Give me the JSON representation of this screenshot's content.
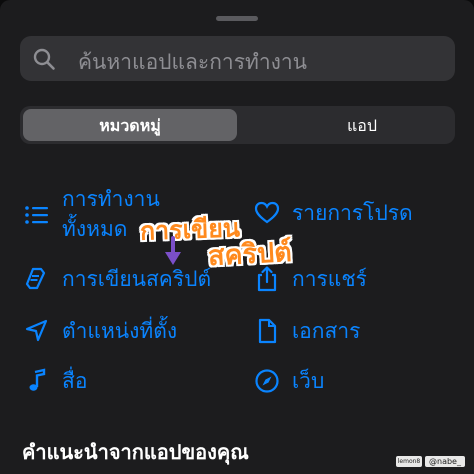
{
  "search": {
    "placeholder": "ค้นหาแอปและการทำงาน"
  },
  "segments": {
    "categories": "หมวดหมู่",
    "apps": "แอป"
  },
  "categories": {
    "all_actions_line1": "การทำงาน",
    "all_actions_line2": "ทั้งหมด",
    "favorites": "รายการโปรด",
    "scripting": "การเขียนสคริปต์",
    "sharing": "การแชร์",
    "location": "ตำแหน่งที่ตั้ง",
    "documents": "เอกสาร",
    "media": "สื่อ",
    "web": "เว็บ"
  },
  "recommend_title": "คำแนะนำจากแอปของคุณ",
  "overlay": {
    "line1": "การเขียน",
    "line2": "สคริปต์",
    "color": "#ff8a1e"
  },
  "watermark": {
    "logo": "lemon8",
    "handle": "@nabe_"
  },
  "colors": {
    "accent": "#0a84ff",
    "sheet": "#1c1c1e"
  }
}
